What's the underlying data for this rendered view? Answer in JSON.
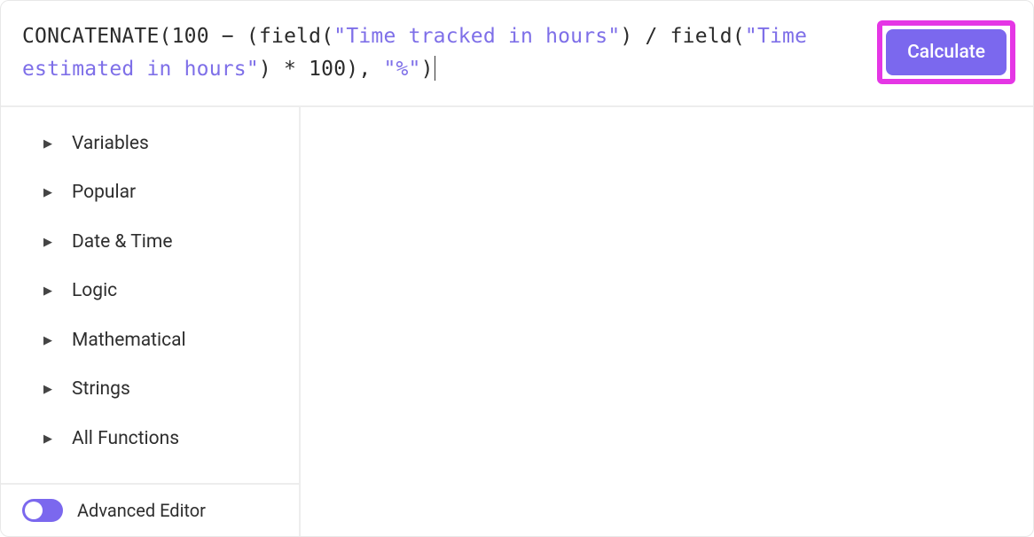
{
  "formula": {
    "fn_concat": "CONCATENATE",
    "open1": "(",
    "num100a": "100",
    "minus": " − ",
    "open2": "(",
    "field1": "field",
    "open3": "(",
    "str1": "\"Time tracked in hours\"",
    "close3": ")",
    "div": " / ",
    "field2": "field",
    "open4": "(",
    "str2": "\"Time estimated in hours\"",
    "close4": ")",
    "mul": " * ",
    "num100b": "100",
    "close2": ")",
    "comma": ", ",
    "str3": "\"%\"",
    "close1": ")"
  },
  "calculate_label": "Calculate",
  "categories": [
    {
      "label": "Variables"
    },
    {
      "label": "Popular"
    },
    {
      "label": "Date & Time"
    },
    {
      "label": "Logic"
    },
    {
      "label": "Mathematical"
    },
    {
      "label": "Strings"
    },
    {
      "label": "All Functions"
    }
  ],
  "advanced_editor_label": "Advanced Editor"
}
